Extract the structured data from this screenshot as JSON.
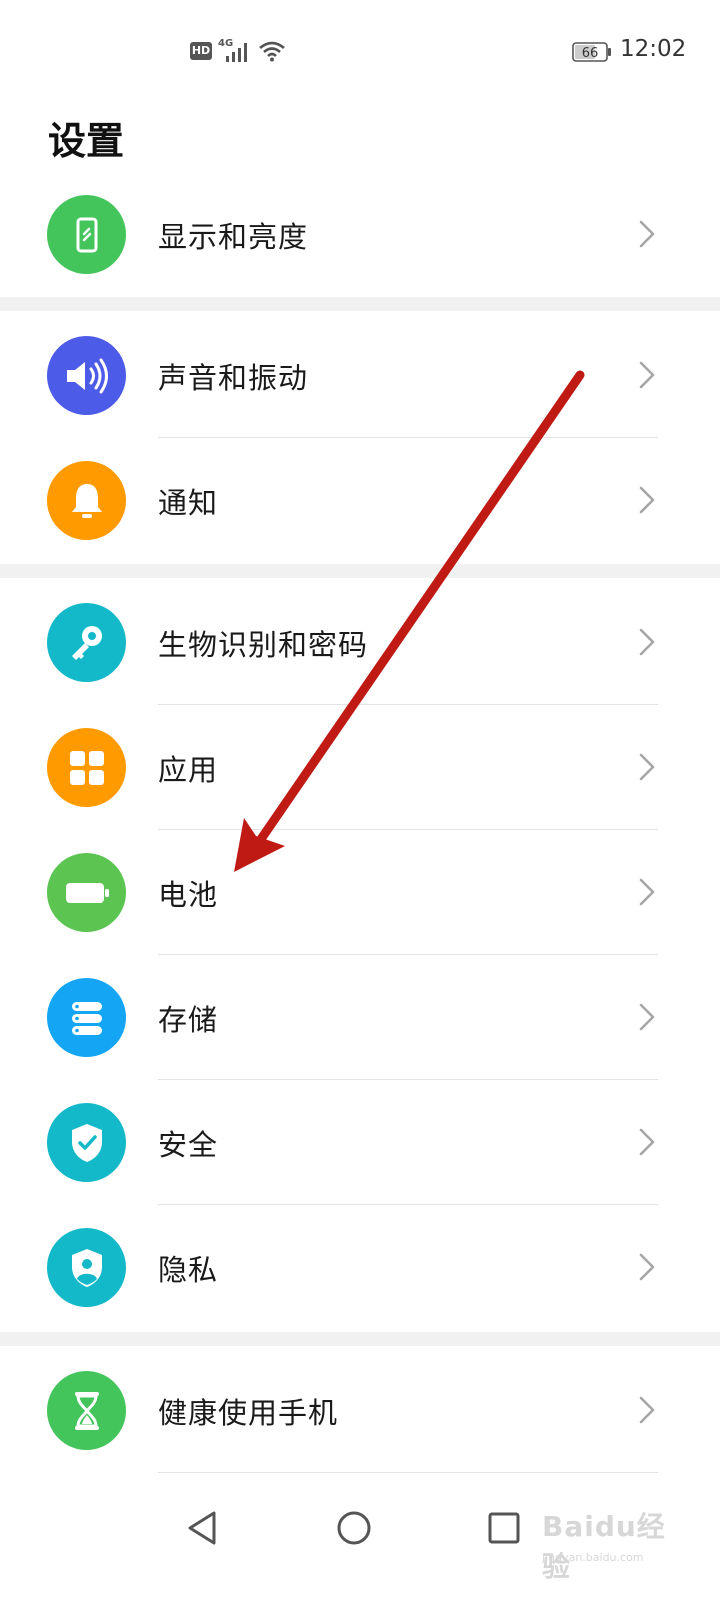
{
  "status_bar": {
    "hd": "HD",
    "network": "4G",
    "battery_level": "66",
    "time": "12:02"
  },
  "title": "设置",
  "settings": [
    {
      "label": "显示和亮度",
      "icon": "display-icon",
      "color": "#43c55c"
    },
    {
      "label": "声音和振动",
      "icon": "speaker-icon",
      "color": "#4c5be8"
    },
    {
      "label": "通知",
      "icon": "bell-icon",
      "color": "#ff9a00"
    },
    {
      "label": "生物识别和密码",
      "icon": "key-icon",
      "color": "#14b9c9"
    },
    {
      "label": "应用",
      "icon": "apps-grid-icon",
      "color": "#ff9a00"
    },
    {
      "label": "电池",
      "icon": "battery-icon",
      "color": "#5cc552"
    },
    {
      "label": "存储",
      "icon": "storage-icon",
      "color": "#14a6f5"
    },
    {
      "label": "安全",
      "icon": "shield-check-icon",
      "color": "#14b9c9"
    },
    {
      "label": "隐私",
      "icon": "privacy-icon",
      "color": "#14b9c9"
    },
    {
      "label": "健康使用手机",
      "icon": "hourglass-icon",
      "color": "#43c55c"
    }
  ],
  "annotation_color": "#c01a14",
  "watermark": {
    "main": "Baidu经验",
    "url": "jingyan.baidu.com"
  }
}
